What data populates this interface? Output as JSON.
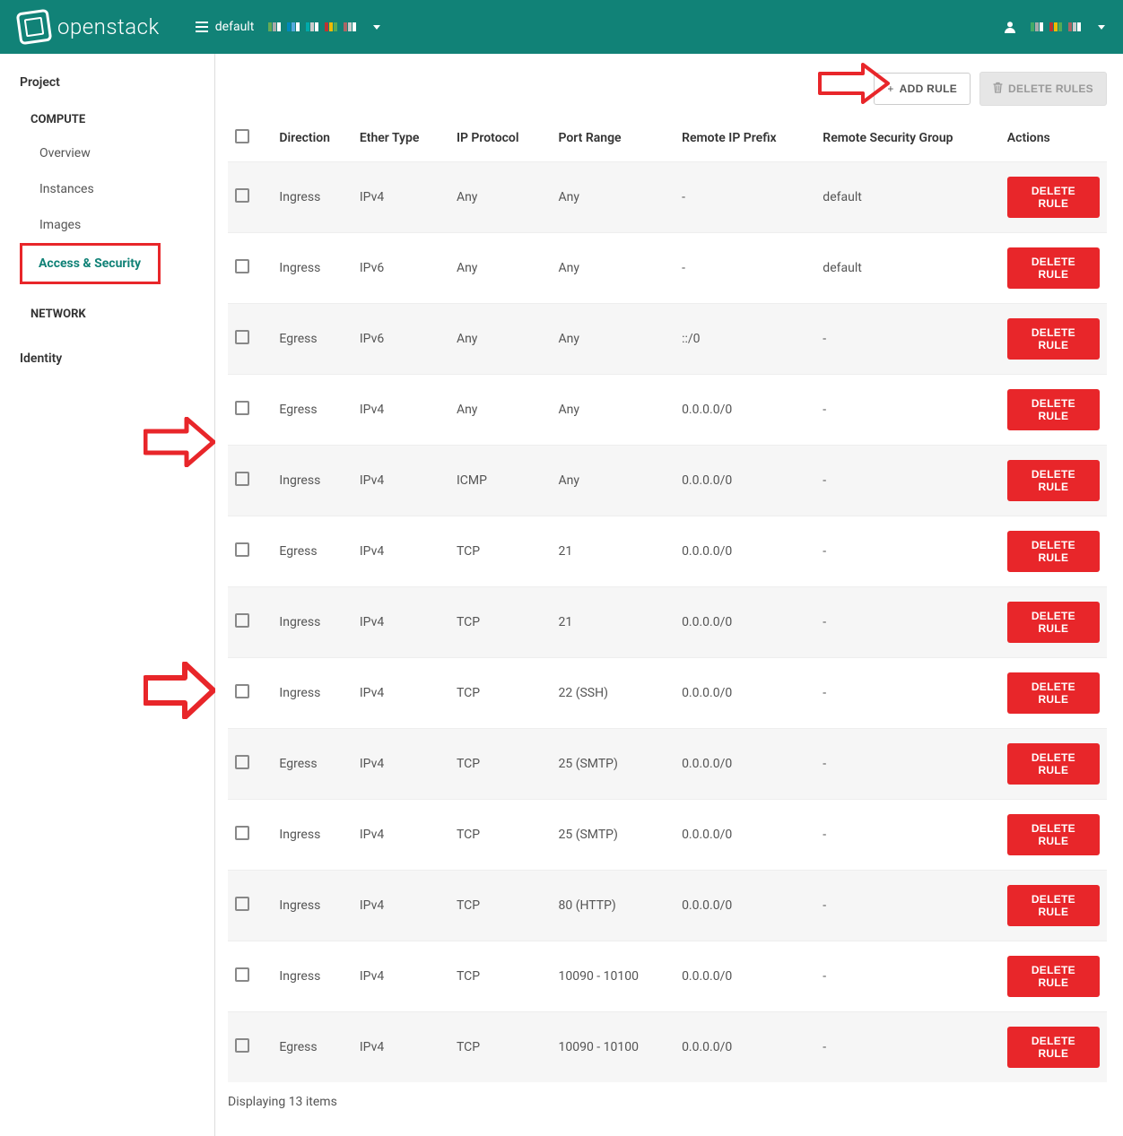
{
  "brand": {
    "name": "openstack"
  },
  "topbar": {
    "project_label": "default"
  },
  "sidebar": {
    "project": "Project",
    "compute": "COMPUTE",
    "overview": "Overview",
    "instances": "Instances",
    "images": "Images",
    "access": "Access & Security",
    "network": "NETWORK",
    "identity": "Identity"
  },
  "actions": {
    "add_rule": "Add Rule",
    "delete_rules": "Delete Rules",
    "delete_rule": "Delete Rule"
  },
  "columns": {
    "direction": "Direction",
    "ether": "Ether Type",
    "proto": "IP Protocol",
    "port": "Port Range",
    "rip": "Remote IP Prefix",
    "rsg": "Remote Security Group",
    "actions": "Actions"
  },
  "rows": [
    {
      "direction": "Ingress",
      "ether": "IPv4",
      "proto": "Any",
      "port": "Any",
      "rip": "-",
      "rsg": "default"
    },
    {
      "direction": "Ingress",
      "ether": "IPv6",
      "proto": "Any",
      "port": "Any",
      "rip": "-",
      "rsg": "default"
    },
    {
      "direction": "Egress",
      "ether": "IPv6",
      "proto": "Any",
      "port": "Any",
      "rip": "::/0",
      "rsg": "-"
    },
    {
      "direction": "Egress",
      "ether": "IPv4",
      "proto": "Any",
      "port": "Any",
      "rip": "0.0.0.0/0",
      "rsg": "-"
    },
    {
      "direction": "Ingress",
      "ether": "IPv4",
      "proto": "ICMP",
      "port": "Any",
      "rip": "0.0.0.0/0",
      "rsg": "-"
    },
    {
      "direction": "Egress",
      "ether": "IPv4",
      "proto": "TCP",
      "port": "21",
      "rip": "0.0.0.0/0",
      "rsg": "-"
    },
    {
      "direction": "Ingress",
      "ether": "IPv4",
      "proto": "TCP",
      "port": "21",
      "rip": "0.0.0.0/0",
      "rsg": "-"
    },
    {
      "direction": "Ingress",
      "ether": "IPv4",
      "proto": "TCP",
      "port": "22 (SSH)",
      "rip": "0.0.0.0/0",
      "rsg": "-"
    },
    {
      "direction": "Egress",
      "ether": "IPv4",
      "proto": "TCP",
      "port": "25 (SMTP)",
      "rip": "0.0.0.0/0",
      "rsg": "-"
    },
    {
      "direction": "Ingress",
      "ether": "IPv4",
      "proto": "TCP",
      "port": "25 (SMTP)",
      "rip": "0.0.0.0/0",
      "rsg": "-"
    },
    {
      "direction": "Ingress",
      "ether": "IPv4",
      "proto": "TCP",
      "port": "80 (HTTP)",
      "rip": "0.0.0.0/0",
      "rsg": "-"
    },
    {
      "direction": "Ingress",
      "ether": "IPv4",
      "proto": "TCP",
      "port": "10090 - 10100",
      "rip": "0.0.0.0/0",
      "rsg": "-"
    },
    {
      "direction": "Egress",
      "ether": "IPv4",
      "proto": "TCP",
      "port": "10090 - 10100",
      "rip": "0.0.0.0/0",
      "rsg": "-"
    }
  ],
  "footer": {
    "displaying": "Displaying 13 items"
  }
}
